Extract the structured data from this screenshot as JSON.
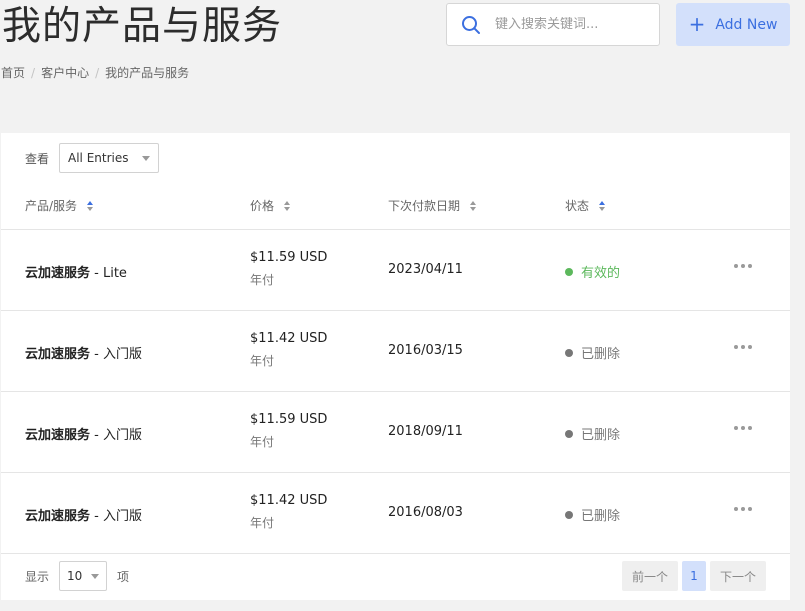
{
  "header": {
    "title": "我的产品与服务",
    "search_placeholder": "键入搜索关键词...",
    "add_label": "Add New"
  },
  "breadcrumb": [
    "首页",
    "客户中心",
    "我的产品与服务"
  ],
  "filter": {
    "label": "查看",
    "selected": "All Entries"
  },
  "table": {
    "columns": [
      "产品/服务",
      "价格",
      "下次付款日期",
      "状态"
    ],
    "rows": [
      {
        "name_bold": "云加速服务",
        "name_rest": " - Lite",
        "price": "$11.59 USD",
        "cycle": "年付",
        "date": "2023/04/11",
        "status": "有效的",
        "status_color": "#5cb85c"
      },
      {
        "name_bold": "云加速服务",
        "name_rest": " - 入门版",
        "price": "$11.42 USD",
        "cycle": "年付",
        "date": "2016/03/15",
        "status": "已删除",
        "status_color": "#777777"
      },
      {
        "name_bold": "云加速服务",
        "name_rest": " - 入门版",
        "price": "$11.59 USD",
        "cycle": "年付",
        "date": "2018/09/11",
        "status": "已删除",
        "status_color": "#777777"
      },
      {
        "name_bold": "云加速服务",
        "name_rest": " - 入门版",
        "price": "$11.42 USD",
        "cycle": "年付",
        "date": "2016/08/03",
        "status": "已删除",
        "status_color": "#777777"
      }
    ]
  },
  "footer": {
    "show_label": "显示",
    "per_page": "10",
    "items_label": "项",
    "prev": "前一个",
    "page": "1",
    "next": "下一个"
  },
  "colors": {
    "accent": "#3b6fe0",
    "accent_bg": "#d3e0fb",
    "active": "#5cb85c",
    "deleted": "#777777"
  }
}
